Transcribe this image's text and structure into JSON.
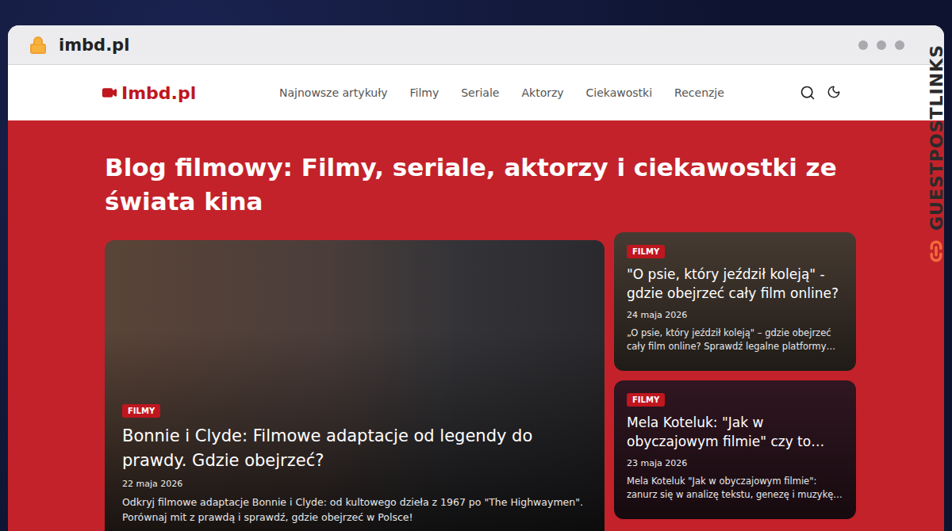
{
  "browser": {
    "address": "imbd.pl"
  },
  "site": {
    "logo": "Imbd.pl",
    "nav": [
      {
        "label": "Najnowsze artykuły",
        "selected": false
      },
      {
        "label": "Filmy",
        "selected": false
      },
      {
        "label": "Seriale",
        "selected": false
      },
      {
        "label": "Aktorzy",
        "selected": false
      },
      {
        "label": "Ciekawostki",
        "selected": false
      },
      {
        "label": "Recenzje",
        "selected": false
      }
    ]
  },
  "hero": {
    "title": "Blog filmowy: Filmy, seriale, aktorzy i ciekawostki ze świata kina"
  },
  "featured": {
    "badge": "FILMY",
    "title": "Bonnie i Clyde: Filmowe adaptacje od legendy do prawdy. Gdzie obejrzeć?",
    "date": "22 maja 2026",
    "excerpt": "Odkryj filmowe adaptacje Bonnie i Clyde: od kultowego dzieła z 1967 po \"The Highwaymen\". Porównaj mit z prawdą i sprawdź, gdzie obejrzeć w Polsce!"
  },
  "side_cards": [
    {
      "badge": "FILMY",
      "title": "\"O psie, który jeździł koleją\" - gdzie obejrzeć cały film online?",
      "date": "24 maja 2026",
      "excerpt": "„O psie, który jeździł koleją\" – gdzie obejrzeć cały film online? Sprawdź legalne platformy…",
      "color": "#6b5a4c"
    },
    {
      "badge": "FILMY",
      "title": "Mela Koteluk: \"Jak w obyczajowym filmie\" czy to…",
      "date": "23 maja 2026",
      "excerpt": "Mela Koteluk \"Jak w obyczajowym filmie\": zanurz się w analizę tekstu, genezę i muzykę…",
      "color": "#4a2232"
    }
  ],
  "watermark": "GUESTPOSTLINKS"
}
